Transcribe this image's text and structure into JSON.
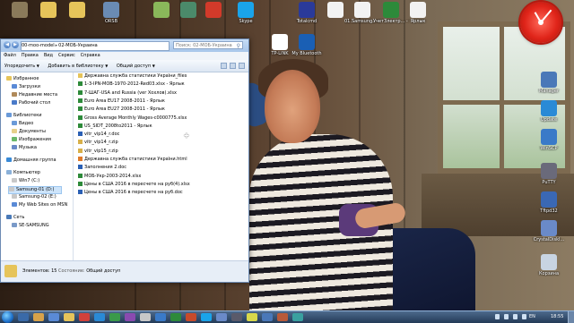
{
  "desktop_icons": [
    {
      "label": "",
      "color": "#8a7a5a"
    },
    {
      "label": "",
      "color": "#e6c45a"
    },
    {
      "label": "",
      "color": "#e6c45a"
    },
    {
      "label": "ORSB",
      "color": "#6a8bb4"
    },
    {
      "label": "",
      "color": "#8ab85a"
    },
    {
      "label": "",
      "color": "#4b8a6a"
    },
    {
      "label": "",
      "color": "#d23a2a"
    },
    {
      "label": "Skype",
      "color": "#1aa4ea"
    },
    {
      "label": "Totalcmd",
      "color": "#2a3a9a"
    },
    {
      "label": "",
      "color": "#f2f2f2"
    },
    {
      "label": "01.Samsung... - Ярлык",
      "color": "#f2f2f2"
    },
    {
      "label": "УчетЗлектр... - Ярлык",
      "color": "#2d8a3a"
    },
    {
      "label": "Ярлык",
      "color": "#f2f2f2"
    },
    {
      "label": "TP-LINK",
      "color": "#ffffff"
    },
    {
      "label": "My Bluetooth",
      "color": "#1a5fb4"
    },
    {
      "label": "Manager",
      "color": "#4a78b8"
    },
    {
      "label": "Update",
      "color": "#2a8ad6"
    },
    {
      "label": "WinSCP",
      "color": "#3a7ac8"
    },
    {
      "label": "PuTTY",
      "color": "#6a6a7a"
    },
    {
      "label": "Tftpd32",
      "color": "#3a68b4"
    },
    {
      "label": "CrystalDiskI...",
      "color": "#6a8ac8"
    },
    {
      "label": "Корзина",
      "color": "#c8d4e2"
    }
  ],
  "explorer": {
    "back_glyph": "◀",
    "forward_glyph": "▶",
    "address_parts": [
      "00-moo-model",
      "02-МОБ-Украина"
    ],
    "address_sep": "▸",
    "search_placeholder": "Поиск: 02-МОБ-Украина",
    "menu": [
      "Файл",
      "Правка",
      "Вид",
      "Сервис",
      "Справка"
    ],
    "toolbar": [
      "Упорядочить",
      "Добавить в библиотеку",
      "Общий доступ"
    ],
    "nav": [
      {
        "label": "Избранное",
        "kind": "head",
        "color": "#e6c45a"
      },
      {
        "label": "Загрузки",
        "kind": "sub",
        "color": "#5a8ad6"
      },
      {
        "label": "Недавние места",
        "kind": "sub",
        "color": "#b08a5a"
      },
      {
        "label": "Рабочий стол",
        "kind": "sub",
        "color": "#4a7ac8"
      },
      {
        "label": "Библиотеки",
        "kind": "head",
        "color": "#6a9ad8"
      },
      {
        "label": "Видео",
        "kind": "sub",
        "color": "#6a9ad8"
      },
      {
        "label": "Документы",
        "kind": "sub",
        "color": "#e6d08a"
      },
      {
        "label": "Изображения",
        "kind": "sub",
        "color": "#6ab86a"
      },
      {
        "label": "Музыка",
        "kind": "sub",
        "color": "#6a8ac8"
      },
      {
        "label": "Домашняя группа",
        "kind": "head",
        "color": "#3a8ad6"
      },
      {
        "label": "Компьютер",
        "kind": "head",
        "color": "#8ab0d8"
      },
      {
        "label": "Win7 (C:)",
        "kind": "sub",
        "color": "#c8c8c8"
      },
      {
        "label": "Samsung-01 (D:)",
        "kind": "sel",
        "color": "#c8c8c8"
      },
      {
        "label": "Samsung-02 (E:)",
        "kind": "sub",
        "color": "#c8c8c8"
      },
      {
        "label": "My Web Sites on MSN",
        "kind": "sub",
        "color": "#5a8ad6"
      },
      {
        "label": "Сеть",
        "kind": "head",
        "color": "#4a7ab8"
      },
      {
        "label": "SE-SAMSUNG",
        "kind": "sub",
        "color": "#7a9ac8"
      }
    ],
    "files": [
      {
        "name": "Державна служба статистики України_files",
        "type": "folder"
      },
      {
        "name": "1-3-IPN-MOB-1970-2012-Red03.xlsx - Ярлык",
        "type": "xls"
      },
      {
        "name": "7-ШАГ-USA and Russia (ver Хохлов).xlsx",
        "type": "xls"
      },
      {
        "name": "Euro Area EU17 2008-2011 - Ярлык",
        "type": "xls"
      },
      {
        "name": "Euro Area EU27 2008-2011 - Ярлык",
        "type": "xls"
      },
      {
        "name": "Gross Average Monthly Wages-c0000775.xlsx",
        "type": "xls"
      },
      {
        "name": "US_SIDT_2008to2011 - Ярлык",
        "type": "xls"
      },
      {
        "name": "vitr_vip14_r.doc",
        "type": "doc"
      },
      {
        "name": "vitr_vip14_r.zip",
        "type": "zip"
      },
      {
        "name": "vitr_vip15_r.zip",
        "type": "zip"
      },
      {
        "name": "Державна служба статистики України.html",
        "type": "html"
      },
      {
        "name": "Заполнения 2.doc",
        "type": "doc"
      },
      {
        "name": "МОБ-Укр-2003-2014.xlsx",
        "type": "xls"
      },
      {
        "name": "Цены в США 2016 в пересчете на руб(4).xlsx",
        "type": "xls"
      },
      {
        "name": "Цены в США 2016 в пересчете на руб.doc",
        "type": "doc"
      }
    ],
    "status": {
      "count": "Элементов: 15",
      "state_label": "Состояние:",
      "state_value": "Общий доступ"
    }
  },
  "file_type_colors": {
    "folder": "#e6c45a",
    "xls": "#2d8a3a",
    "doc": "#2a5fb4",
    "zip": "#d8b04a",
    "html": "#e07a2a"
  },
  "taskbar": {
    "apps": [
      {
        "color": "#3a6aa8"
      },
      {
        "color": "#d8a24a"
      },
      {
        "color": "#5a8ad6"
      },
      {
        "color": "#e6c45a"
      },
      {
        "color": "#d2413a"
      },
      {
        "color": "#2a8ad6"
      },
      {
        "color": "#3a9a4a"
      },
      {
        "color": "#8a4ab0"
      },
      {
        "color": "#c8c8c8"
      },
      {
        "color": "#3a7ac8"
      },
      {
        "color": "#2d8a3a"
      },
      {
        "color": "#c84a2a"
      },
      {
        "color": "#1aa4ea"
      },
      {
        "color": "#6a8ac8"
      },
      {
        "color": "#5a5a6a"
      },
      {
        "color": "#d8d84a"
      },
      {
        "color": "#4a78b8"
      },
      {
        "color": "#b85a3a"
      },
      {
        "color": "#3aa0a0"
      }
    ],
    "lang": "EN",
    "time": "18:55"
  }
}
